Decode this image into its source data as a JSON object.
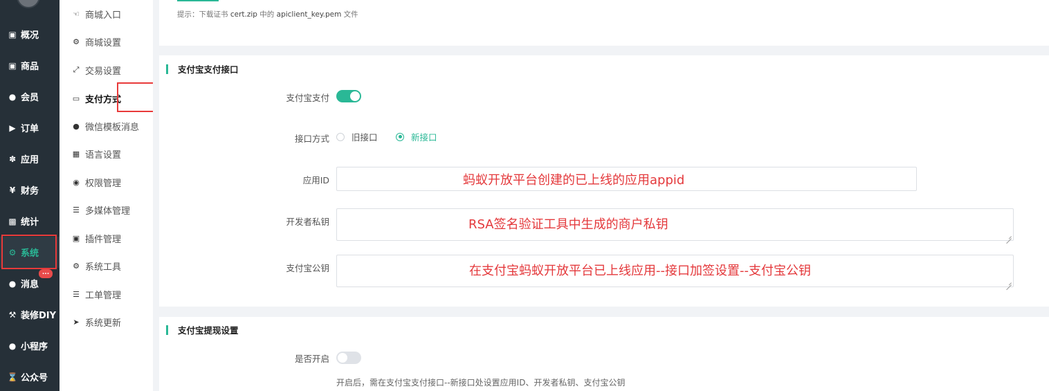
{
  "nav": {
    "items": [
      {
        "label": "概况",
        "icon": "dashboard-icon"
      },
      {
        "label": "商品",
        "icon": "box-icon"
      },
      {
        "label": "会员",
        "icon": "users-icon"
      },
      {
        "label": "订单",
        "icon": "cart-icon"
      },
      {
        "label": "应用",
        "icon": "apps-icon"
      },
      {
        "label": "财务",
        "icon": "yen-icon"
      },
      {
        "label": "统计",
        "icon": "bar-chart-icon"
      },
      {
        "label": "系统",
        "icon": "gears-icon",
        "active": true
      },
      {
        "label": "消息",
        "icon": "chat-icon",
        "badge": "..."
      },
      {
        "label": "装修DIY",
        "icon": "hammer-icon"
      },
      {
        "label": "小程序",
        "icon": "wechat-icon"
      },
      {
        "label": "公众号",
        "icon": "hourglass-icon"
      }
    ]
  },
  "subnav": {
    "items": [
      {
        "label": "商城入口",
        "icon": "pointer-hand-icon"
      },
      {
        "label": "商城设置",
        "icon": "gear-icon"
      },
      {
        "label": "交易设置",
        "icon": "compress-icon"
      },
      {
        "label": "支付方式",
        "icon": "credit-card-icon",
        "active": true
      },
      {
        "label": "微信模板消息",
        "icon": "wechat-icon"
      },
      {
        "label": "语言设置",
        "icon": "translate-icon"
      },
      {
        "label": "权限管理",
        "icon": "mask-icon"
      },
      {
        "label": "多媒体管理",
        "icon": "list-icon"
      },
      {
        "label": "插件管理",
        "icon": "puzzle-icon"
      },
      {
        "label": "系统工具",
        "icon": "gear-icon"
      },
      {
        "label": "工单管理",
        "icon": "list-icon"
      },
      {
        "label": "系统更新",
        "icon": "paper-plane-icon"
      }
    ]
  },
  "top_hint": {
    "prefix": "提示：下载证书 ",
    "file": "cert.zip",
    "middle": " 中的 ",
    "key": "apiclient_key.pem",
    "suffix": " 文件"
  },
  "alipay": {
    "title": "支付宝支付接口",
    "pay_label": "支付宝支付",
    "pay_enabled": true,
    "mode_label": "接口方式",
    "mode_options": [
      "旧接口",
      "新接口"
    ],
    "mode_selected": "新接口",
    "app_id_label": "应用ID",
    "app_id_annotation": "蚂蚁开放平台创建的已上线的应用appid",
    "private_key_label": "开发者私钥",
    "private_key_annotation": "RSA签名验证工具中生成的商户私钥",
    "public_key_label": "支付宝公钥",
    "public_key_annotation": "在支付宝蚂蚁开放平台已上线应用--接口加签设置--支付宝公钥"
  },
  "withdraw": {
    "title": "支付宝提现设置",
    "enable_label": "是否开启",
    "enabled": false,
    "note": "开启后，需在支付宝支付接口--新接口处设置应用ID、开发者私钥、支付宝公钥"
  },
  "colors": {
    "accent": "#2ab896",
    "highlight": "#e83a3a",
    "annotation": "#e4393c",
    "nav_bg": "#263038"
  }
}
